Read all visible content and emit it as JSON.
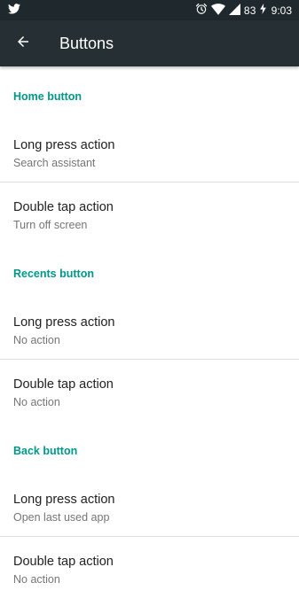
{
  "status_bar": {
    "battery_level": "83",
    "time": "9:03",
    "bg_color": "#1f282d",
    "icons": [
      "twitter-icon",
      "alarm-icon",
      "wifi-icon",
      "signal-icon",
      "battery-charging-icon"
    ]
  },
  "toolbar": {
    "title": "Buttons",
    "back_icon": "arrow-back-icon",
    "bg_color": "#262f34"
  },
  "accent_color": "#009688",
  "sections": [
    {
      "header": "Home button",
      "items": [
        {
          "title": "Long press action",
          "summary": "Search assistant"
        },
        {
          "title": "Double tap action",
          "summary": "Turn off screen"
        }
      ]
    },
    {
      "header": "Recents button",
      "items": [
        {
          "title": "Long press action",
          "summary": "No action"
        },
        {
          "title": "Double tap action",
          "summary": "No action"
        }
      ]
    },
    {
      "header": "Back button",
      "items": [
        {
          "title": "Long press action",
          "summary": "Open last used app"
        },
        {
          "title": "Double tap action",
          "summary": "No action"
        }
      ]
    }
  ]
}
